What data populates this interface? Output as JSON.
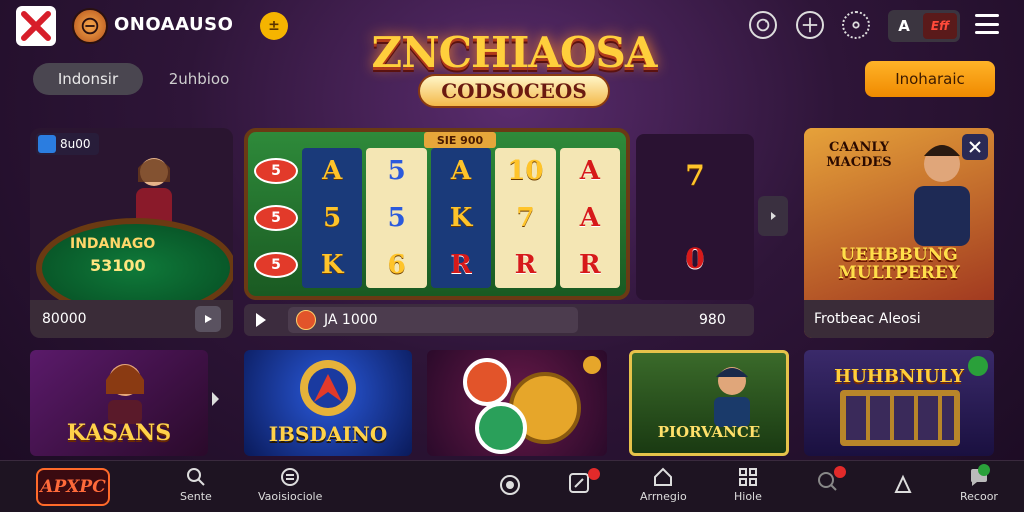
{
  "header": {
    "brand": "ONOAAUSO",
    "coin_glyph": "±",
    "account_badge_left": "A",
    "account_badge_right": "Eff"
  },
  "hero": {
    "title": "ZNCHIAOSA",
    "subtitle": "CODSOCEOS"
  },
  "tabs": [
    {
      "label": "Indonsir"
    },
    {
      "label": "2uhbioo"
    }
  ],
  "promo_button": "Inoharaic",
  "featured_table": {
    "badge": "8u00",
    "title": "INDANAGO",
    "amount": "53100",
    "footer_value": "80000"
  },
  "slot": {
    "top_label": "SIE 900",
    "left_column": [
      "5",
      "5",
      "5"
    ],
    "reels": [
      [
        "A",
        "5",
        "K"
      ],
      [
        "5",
        "5",
        "6"
      ],
      [
        "A",
        "K",
        "R"
      ],
      [
        "10",
        "7",
        "R"
      ],
      [
        "A",
        "A",
        "R"
      ]
    ],
    "bet_label": "JA 1000",
    "bet_value": "980"
  },
  "jackpot_column": [
    "7",
    "0"
  ],
  "multiplayer_card": {
    "title": "CAANLY MACDES",
    "banner": "UEHBBUNG MULTPEREY",
    "footer": "Frotbeac Aleosi"
  },
  "thumbs": [
    {
      "label": "KASANS"
    },
    {
      "label": "IBSDAINO"
    },
    {
      "label": ""
    },
    {
      "label": "PIORVANCE"
    },
    {
      "label": "HUHBNIULY"
    }
  ],
  "bottom_nav": {
    "logo": "APXPC",
    "items": [
      {
        "label": "Sente"
      },
      {
        "label": "Vaoisiociole"
      },
      {
        "label": ""
      },
      {
        "label": ""
      },
      {
        "label": "Arrnegio"
      },
      {
        "label": "Hiole"
      },
      {
        "label": ""
      },
      {
        "label": ""
      },
      {
        "label": "Recoor"
      }
    ]
  },
  "colors": {
    "accent": "#f5a623",
    "bg_dark": "#1b0b22",
    "felt_green": "#0f7a3a"
  }
}
